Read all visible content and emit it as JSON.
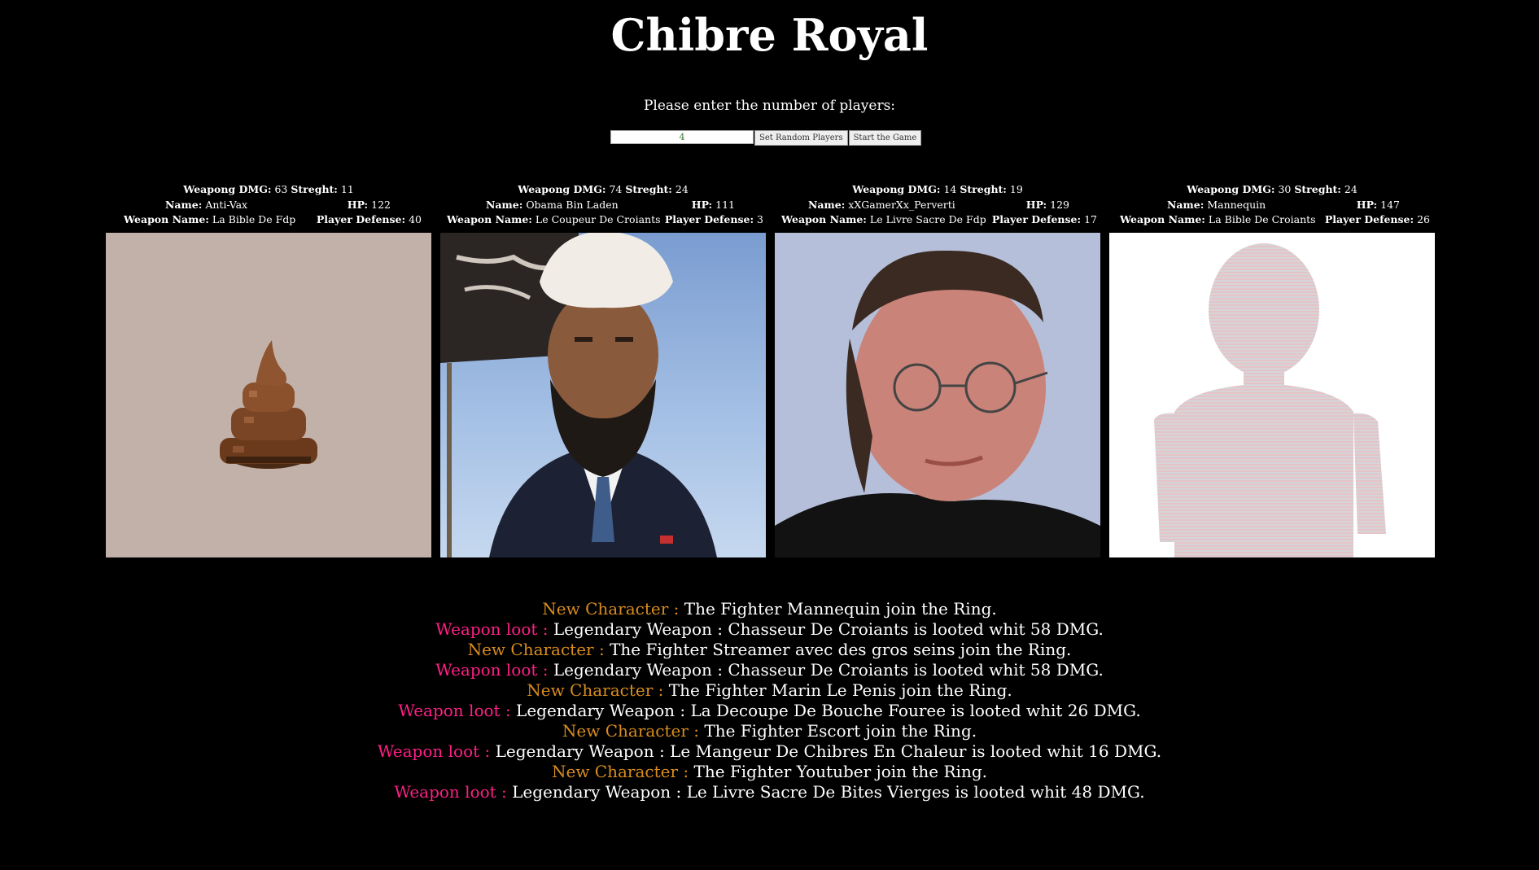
{
  "title": "Chibre Royal",
  "prompt": "Please enter the number of players:",
  "controls": {
    "players_value": "4",
    "random_button": "Set Random Players",
    "start_button": "Start the Game"
  },
  "labels": {
    "dmg": "Weapong DMG:",
    "strength": "Streght:",
    "name": "Name:",
    "hp": "HP:",
    "weapon": "Weapon Name:",
    "defense": "Player Defense:"
  },
  "players": [
    {
      "dmg": "63",
      "strength": "11",
      "name": "Anti-Vax",
      "hp": "122",
      "weapon": "La Bible De Fdp",
      "defense": "40",
      "image": "poop-emoji-pixel"
    },
    {
      "dmg": "74",
      "strength": "24",
      "name": "Obama Bin Laden",
      "hp": "111",
      "weapon": "Le Coupeur De Croiants",
      "defense": "3",
      "image": "man-in-turban-with-beard-portrait"
    },
    {
      "dmg": "14",
      "strength": "19",
      "name": "xXGamerXx_Perverti",
      "hp": "129",
      "weapon": "Le Livre Sacre De Fdp",
      "defense": "17",
      "image": "man-with-glasses-portrait"
    },
    {
      "dmg": "30",
      "strength": "24",
      "name": "Mannequin",
      "hp": "147",
      "weapon": "La Bible De Croiants",
      "defense": "26",
      "image": "mannequin-figure"
    }
  ],
  "log": [
    {
      "tag": "New Character :",
      "kind": "new",
      "text": "The Fighter Mannequin join the Ring."
    },
    {
      "tag": "Weapon loot :",
      "kind": "loot",
      "text": "Legendary Weapon : Chasseur De Croiants is looted whit 58 DMG."
    },
    {
      "tag": "New Character :",
      "kind": "new",
      "text": "The Fighter Streamer avec des gros seins join the Ring."
    },
    {
      "tag": "Weapon loot :",
      "kind": "loot",
      "text": "Legendary Weapon : Chasseur De Croiants is looted whit 58 DMG."
    },
    {
      "tag": "New Character :",
      "kind": "new",
      "text": "The Fighter Marin Le Penis join the Ring."
    },
    {
      "tag": "Weapon loot :",
      "kind": "loot",
      "text": "Legendary Weapon : La Decoupe De Bouche Fouree is looted whit 26 DMG."
    },
    {
      "tag": "New Character :",
      "kind": "new",
      "text": "The Fighter Escort join the Ring."
    },
    {
      "tag": "Weapon loot :",
      "kind": "loot",
      "text": "Legendary Weapon : Le Mangeur De Chibres En Chaleur is looted whit 16 DMG."
    },
    {
      "tag": "New Character :",
      "kind": "new",
      "text": "The Fighter Youtuber join the Ring."
    },
    {
      "tag": "Weapon loot :",
      "kind": "loot",
      "text": "Legendary Weapon : Le Livre Sacre De Bites Vierges is looted whit 48 DMG."
    }
  ],
  "colors": {
    "background": "#000000",
    "new_character": "#d98c1e",
    "weapon_loot": "#ff1f86",
    "input_text": "#3a7a3a"
  }
}
